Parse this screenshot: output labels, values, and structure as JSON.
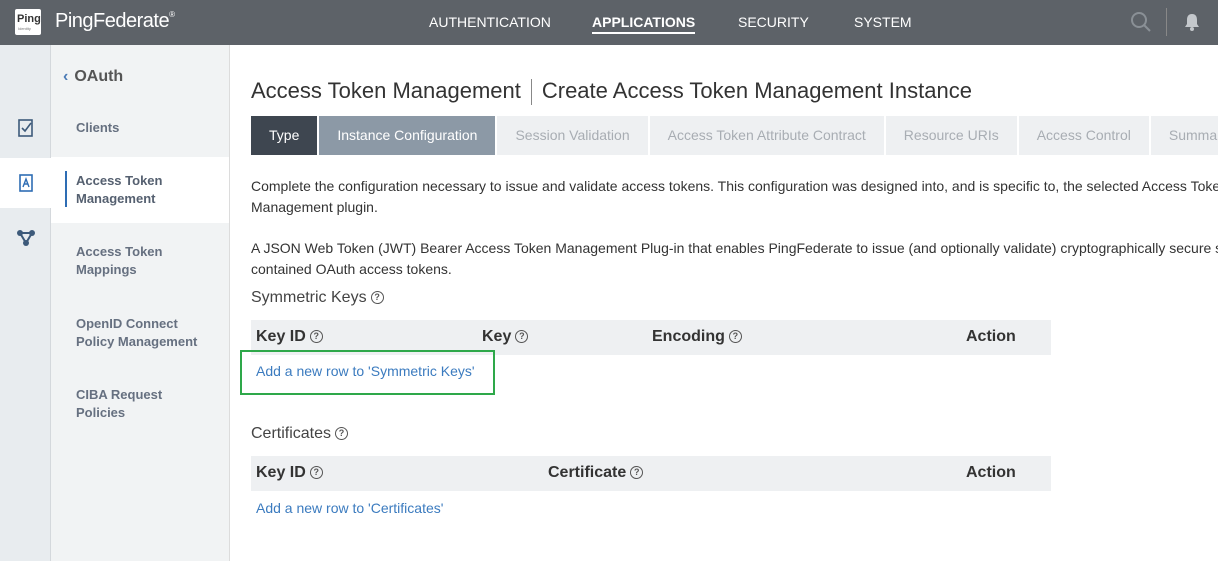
{
  "header": {
    "logo_text": "Ping",
    "logo_subtext": "Identity",
    "brand": "PingFederate",
    "brand_mark": "®",
    "nav": [
      "AUTHENTICATION",
      "APPLICATIONS",
      "SECURITY",
      "SYSTEM"
    ],
    "active_nav": "APPLICATIONS"
  },
  "subnav": {
    "back_label": "OAuth",
    "items": [
      {
        "line1": "Clients",
        "line2": ""
      },
      {
        "line1": "Access Token",
        "line2": "Management"
      },
      {
        "line1": "Access Token",
        "line2": "Mappings"
      },
      {
        "line1": "OpenID Connect",
        "line2": "Policy Management"
      },
      {
        "line1": "CIBA Request",
        "line2": "Policies"
      }
    ]
  },
  "page": {
    "title": "Access Token Management",
    "subtitle": "Create Access Token Management Instance",
    "tabs": [
      "Type",
      "Instance Configuration",
      "Session Validation",
      "Access Token Attribute Contract",
      "Resource URIs",
      "Access Control",
      "Summary"
    ],
    "desc1_line1": "Complete the configuration necessary to issue and validate access tokens. This configuration was designed into, and is specific to, the selected Access Token",
    "desc1_line2": "Management plugin.",
    "desc2_line1": "A JSON Web Token (JWT) Bearer Access Token Management Plug-in that enables PingFederate to issue (and optionally validate) cryptographically secure self-",
    "desc2_line2": "contained OAuth access tokens.",
    "help_glyph": "?"
  },
  "symmetric_keys": {
    "title": "Symmetric Keys",
    "columns": [
      "Key ID",
      "Key",
      "Encoding",
      "Action"
    ],
    "add_link": "Add a new row to 'Symmetric Keys'"
  },
  "certificates": {
    "title": "Certificates",
    "columns": [
      "Key ID",
      "Certificate",
      "Action"
    ],
    "add_link": "Add a new row to 'Certificates'"
  },
  "colors": {
    "topbar": "#5d6268",
    "link": "#3b7bbf",
    "highlight": "#2ea84a",
    "tab_done": "#3e4650",
    "tab_current": "#8c99a6"
  }
}
